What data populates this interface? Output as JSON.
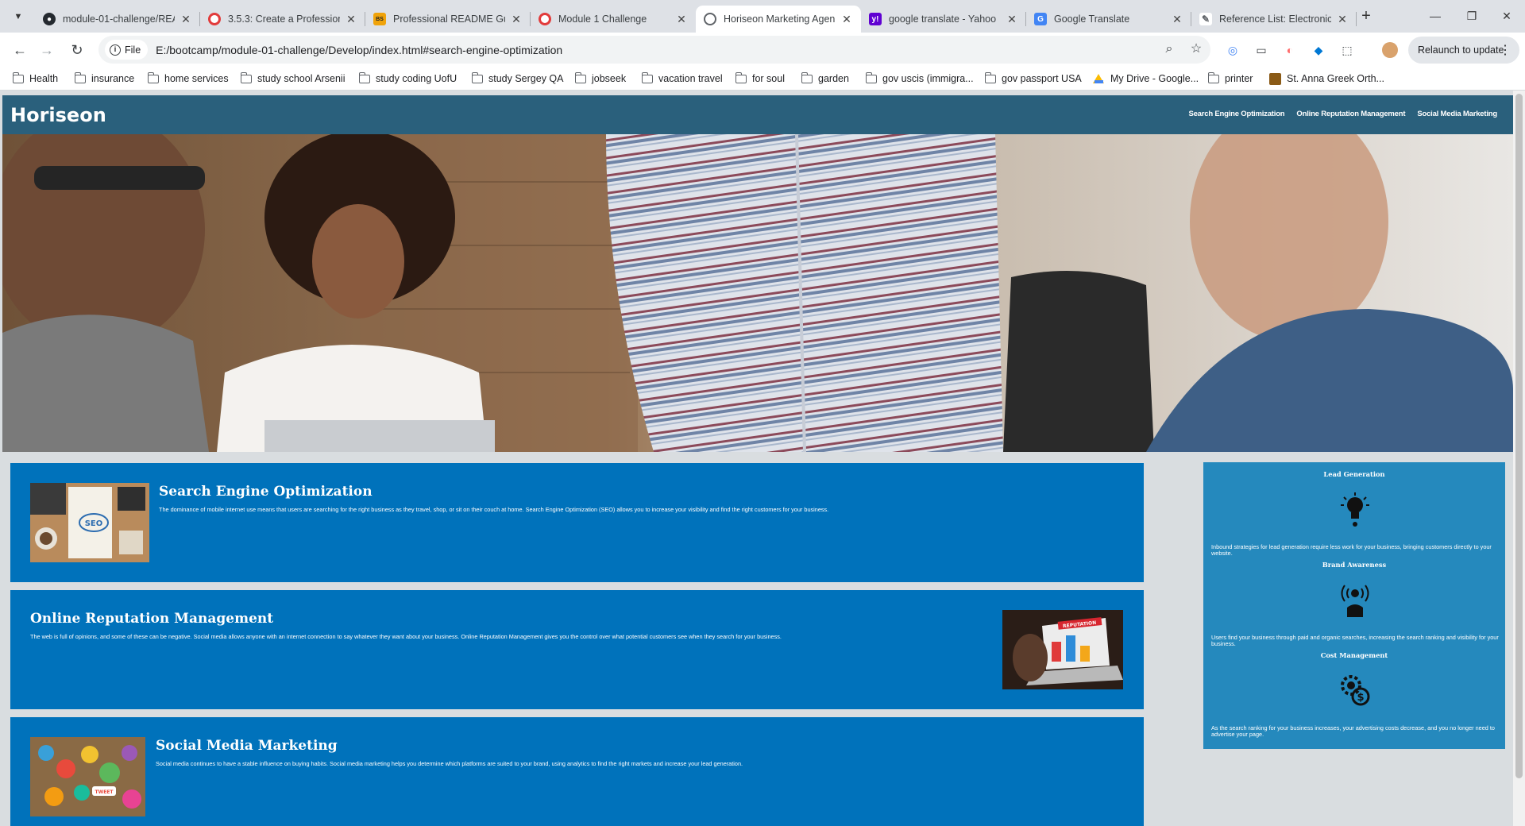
{
  "tabs": [
    {
      "title": "module-01-challenge/REA",
      "favicon": "github-icon",
      "color": "#24292f"
    },
    {
      "title": "3.5.3: Create a Professiona",
      "favicon": "canvas-icon",
      "color": "#e23b3b"
    },
    {
      "title": "Professional README Gui",
      "favicon": "bootcamp-icon",
      "color": "#f0a30a"
    },
    {
      "title": "Module 1 Challenge",
      "favicon": "canvas-icon",
      "color": "#e23b3b"
    },
    {
      "title": "Horiseon Marketing Agen",
      "favicon": "globe-icon",
      "color": "#5f6368",
      "active": true
    },
    {
      "title": "google translate - Yahoo",
      "favicon": "yahoo-icon",
      "color": "#6001d2"
    },
    {
      "title": "Google Translate",
      "favicon": "translate-icon",
      "color": "#4285f4"
    },
    {
      "title": "Reference List: Electronic",
      "favicon": "purdue-owl-icon",
      "color": "#5f6368"
    }
  ],
  "address": {
    "chip": "File",
    "url": "E:/bootcamp/module-01-challenge/Develop/index.html#search-engine-optimization"
  },
  "toolbar": {
    "relaunch": "Relaunch to update"
  },
  "bookmarks": [
    {
      "label": "Health",
      "icon": "folder-icon"
    },
    {
      "label": "insurance",
      "icon": "folder-icon"
    },
    {
      "label": "home services",
      "icon": "folder-icon"
    },
    {
      "label": "study school Arsenii",
      "icon": "folder-icon"
    },
    {
      "label": "study coding UofU",
      "icon": "folder-icon"
    },
    {
      "label": "study Sergey QA",
      "icon": "folder-icon"
    },
    {
      "label": "jobseek",
      "icon": "folder-icon"
    },
    {
      "label": "vacation travel",
      "icon": "folder-icon"
    },
    {
      "label": "for soul",
      "icon": "folder-icon"
    },
    {
      "label": "garden",
      "icon": "folder-icon"
    },
    {
      "label": "gov uscis (immigra...",
      "icon": "folder-icon"
    },
    {
      "label": "gov passport USA",
      "icon": "folder-icon"
    },
    {
      "label": "My Drive - Google...",
      "icon": "google-drive-icon"
    },
    {
      "label": "printer",
      "icon": "folder-icon"
    },
    {
      "label": "St. Anna Greek Orth...",
      "icon": "church-icon"
    }
  ],
  "site": {
    "logo": "Horiseon",
    "nav": [
      "Search Engine Optimization",
      "Online Reputation Management",
      "Social Media Marketing"
    ],
    "sections": [
      {
        "title": "Search Engine Optimization",
        "text": "The dominance of mobile internet use means that users are searching for the right business as they travel, shop, or sit on their couch at home. Search Engine Optimization (SEO) allows you to increase your visibility and find the right customers for your business."
      },
      {
        "title": "Online Reputation Management",
        "text": "The web is full of opinions, and some of these can be negative. Social media allows anyone with an internet connection to say whatever they want about your business. Online Reputation Management gives you the control over what potential customers see when they search for your business."
      },
      {
        "title": "Social Media Marketing",
        "text": "Social media continues to have a stable influence on buying habits. Social media marketing helps you determine which platforms are suited to your brand, using analytics to find the right markets and increase your lead generation."
      }
    ],
    "seo_image_text": "SEO",
    "reputation_image_text": "REPUTATION",
    "social_image_text": "TWEET",
    "benefits": [
      {
        "title": "Lead Generation",
        "icon": "lightbulb-icon",
        "text": "Inbound strategies for lead generation require less work for your business, bringing customers directly to your website."
      },
      {
        "title": "Brand Awareness",
        "icon": "broadcast-person-icon",
        "text": "Users find your business through paid and organic searches, increasing the search ranking and visibility for your business."
      },
      {
        "title": "Cost Management",
        "icon": "gear-dollar-icon",
        "text": "As the search ranking for your business increases, your advertising costs decrease, and you no longer need to advertise your page."
      }
    ]
  },
  "colors": {
    "header": "#2a607c",
    "section": "#0072bb",
    "benefits": "#2589bd",
    "page_bg": "#d9dde0"
  }
}
